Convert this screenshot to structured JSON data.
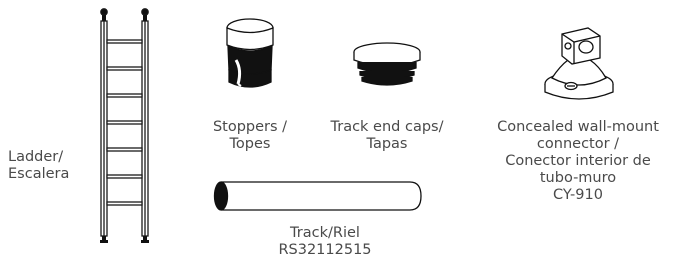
{
  "parts": {
    "ladder": {
      "line1": "Ladder/",
      "line2": "Escalera",
      "icon": "ladder-icon"
    },
    "stoppers": {
      "line1": "Stoppers /",
      "line2": "Topes",
      "icon": "stopper-icon"
    },
    "end_caps": {
      "line1": "Track end caps/",
      "line2": "Tapas",
      "icon": "end-cap-icon"
    },
    "connector": {
      "line1": "Concealed wall-mount",
      "line2": "connector /",
      "line3": "Conector interior de",
      "line4": "tubo-muro",
      "line5": "CY-910",
      "icon": "wall-connector-icon"
    },
    "track": {
      "line1": "Track/Riel",
      "line2": "RS32112515",
      "icon": "track-tube-icon"
    }
  },
  "colors": {
    "line": "#1a1a1a",
    "text": "#4a4a4a",
    "fill": "#111111"
  }
}
